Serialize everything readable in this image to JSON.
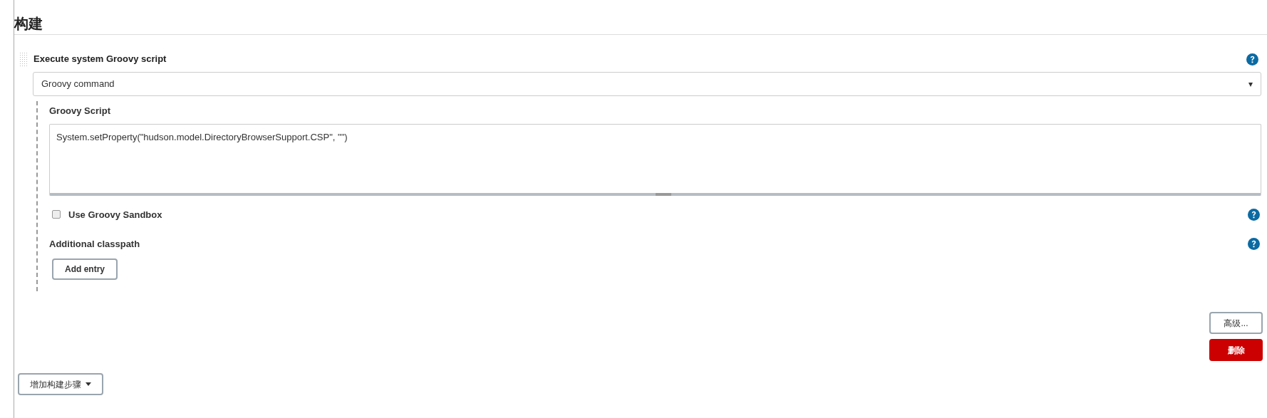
{
  "section": {
    "title": "构建"
  },
  "step": {
    "title": "Execute system Groovy script",
    "select": {
      "value": "Groovy command",
      "arrow": "▾"
    },
    "script_label": "Groovy Script",
    "script": {
      "value": "System.setProperty(\"hudson.model.DirectoryBrowserSupport.CSP\", \"\")"
    },
    "sandbox": {
      "label": "Use Groovy Sandbox",
      "checked": false
    },
    "classpath_label": "Additional classpath",
    "add_entry": "Add entry",
    "advanced": "高级...",
    "delete": "删除"
  },
  "add_step": {
    "label": "增加构建步骤"
  }
}
